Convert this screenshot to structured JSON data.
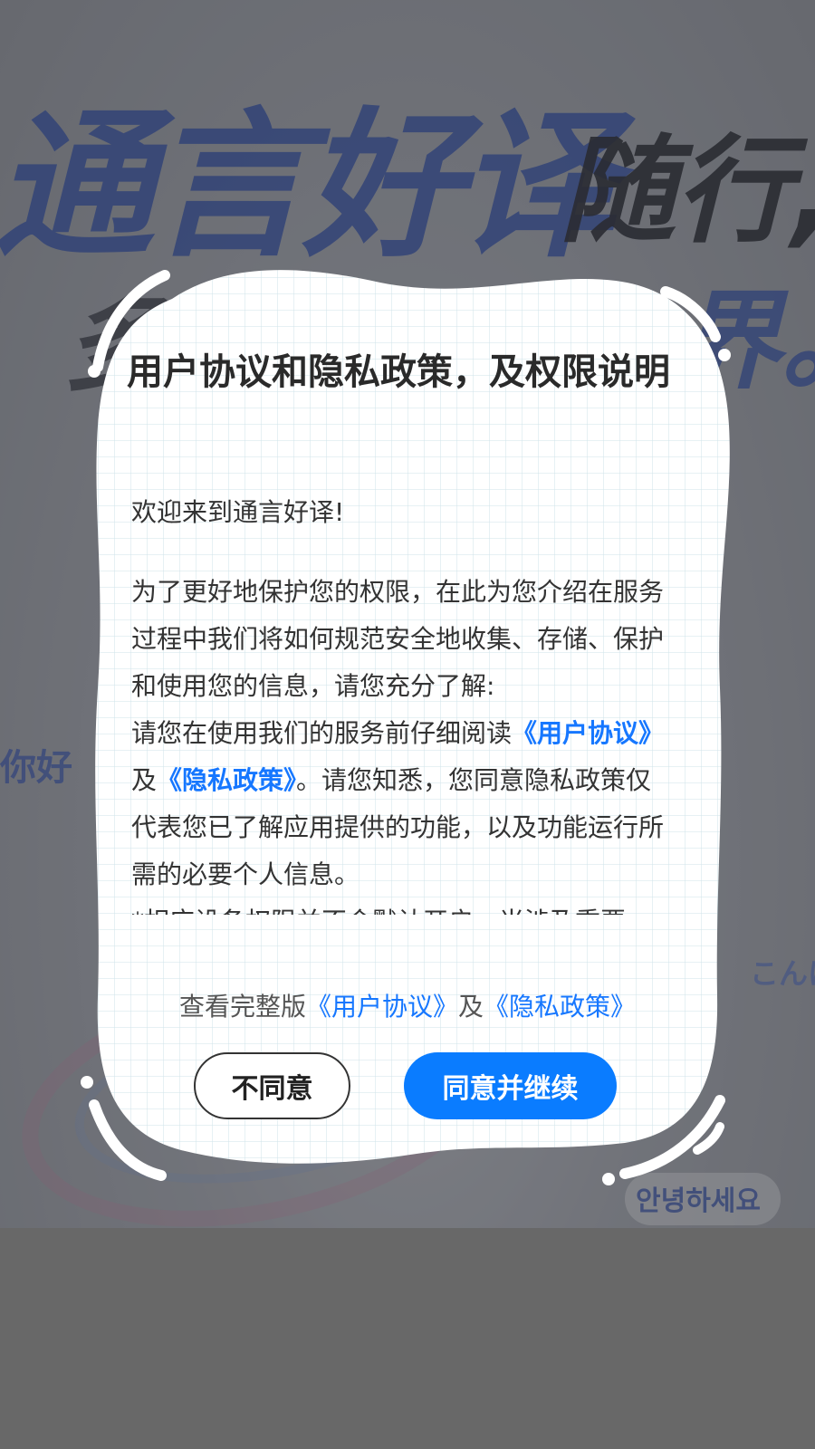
{
  "background": {
    "headline_blue": "通言好译",
    "headline_dark": "随行,",
    "line2_left": "多",
    "line2_right": "界。",
    "bubble_hello": "你好",
    "bubble_jp": "こんに",
    "bubble_kr": "안녕하세요"
  },
  "dialog": {
    "title": "用户协议和隐私政策，及权限说明",
    "welcome": "欢迎来到通言好译!",
    "para1": "为了更好地保护您的权限，在此为您介绍在服务过程中我们将如何规范安全地收集、存储、保护和使用您的信息，请您充分了解:",
    "para2_prefix": "请您在使用我们的服务前仔细阅读",
    "user_agreement_link": "《用户协议》",
    "and": "及",
    "privacy_policy_link": "《隐私政策》",
    "para2_suffix": "。请您知悉，您同意隐私政策仅代表您已了解应用提供的功能，以及功能运行所需的必要个人信息。",
    "para3": "*相应设备权限并不会默认开启，当涉及重要",
    "full_version_prefix": "查看完整版",
    "full_user_agreement": "《用户协议》",
    "full_and": "及",
    "full_privacy_policy": "《隐私政策》",
    "disagree_label": "不同意",
    "agree_label": "同意并继续"
  },
  "colors": {
    "accent": "#0a7cff",
    "link": "#1677ff",
    "overlay": "#686868"
  }
}
